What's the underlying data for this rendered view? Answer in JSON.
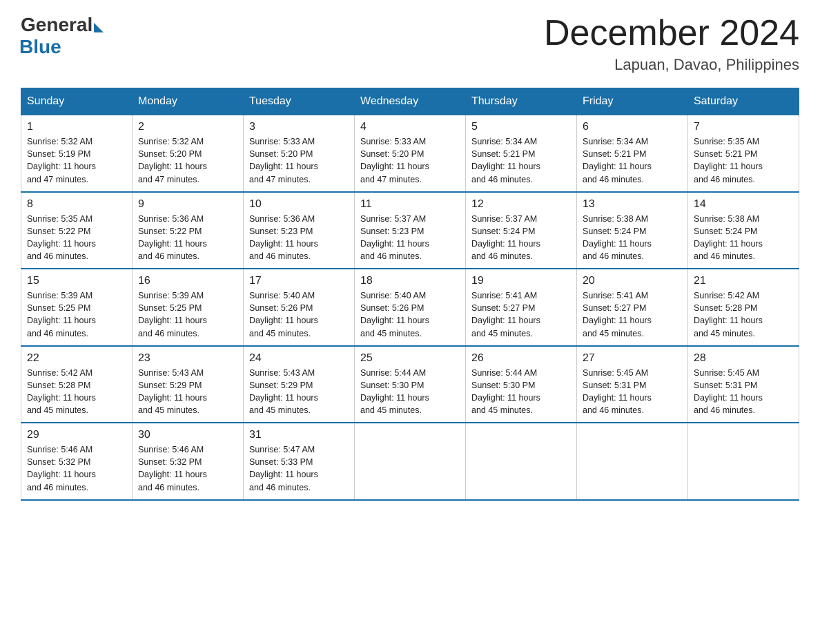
{
  "header": {
    "logo_general": "General",
    "logo_blue": "Blue",
    "month_title": "December 2024",
    "location": "Lapuan, Davao, Philippines"
  },
  "days_of_week": [
    "Sunday",
    "Monday",
    "Tuesday",
    "Wednesday",
    "Thursday",
    "Friday",
    "Saturday"
  ],
  "weeks": [
    [
      {
        "day": "1",
        "sunrise": "5:32 AM",
        "sunset": "5:19 PM",
        "daylight": "11 hours and 47 minutes."
      },
      {
        "day": "2",
        "sunrise": "5:32 AM",
        "sunset": "5:20 PM",
        "daylight": "11 hours and 47 minutes."
      },
      {
        "day": "3",
        "sunrise": "5:33 AM",
        "sunset": "5:20 PM",
        "daylight": "11 hours and 47 minutes."
      },
      {
        "day": "4",
        "sunrise": "5:33 AM",
        "sunset": "5:20 PM",
        "daylight": "11 hours and 47 minutes."
      },
      {
        "day": "5",
        "sunrise": "5:34 AM",
        "sunset": "5:21 PM",
        "daylight": "11 hours and 46 minutes."
      },
      {
        "day": "6",
        "sunrise": "5:34 AM",
        "sunset": "5:21 PM",
        "daylight": "11 hours and 46 minutes."
      },
      {
        "day": "7",
        "sunrise": "5:35 AM",
        "sunset": "5:21 PM",
        "daylight": "11 hours and 46 minutes."
      }
    ],
    [
      {
        "day": "8",
        "sunrise": "5:35 AM",
        "sunset": "5:22 PM",
        "daylight": "11 hours and 46 minutes."
      },
      {
        "day": "9",
        "sunrise": "5:36 AM",
        "sunset": "5:22 PM",
        "daylight": "11 hours and 46 minutes."
      },
      {
        "day": "10",
        "sunrise": "5:36 AM",
        "sunset": "5:23 PM",
        "daylight": "11 hours and 46 minutes."
      },
      {
        "day": "11",
        "sunrise": "5:37 AM",
        "sunset": "5:23 PM",
        "daylight": "11 hours and 46 minutes."
      },
      {
        "day": "12",
        "sunrise": "5:37 AM",
        "sunset": "5:24 PM",
        "daylight": "11 hours and 46 minutes."
      },
      {
        "day": "13",
        "sunrise": "5:38 AM",
        "sunset": "5:24 PM",
        "daylight": "11 hours and 46 minutes."
      },
      {
        "day": "14",
        "sunrise": "5:38 AM",
        "sunset": "5:24 PM",
        "daylight": "11 hours and 46 minutes."
      }
    ],
    [
      {
        "day": "15",
        "sunrise": "5:39 AM",
        "sunset": "5:25 PM",
        "daylight": "11 hours and 46 minutes."
      },
      {
        "day": "16",
        "sunrise": "5:39 AM",
        "sunset": "5:25 PM",
        "daylight": "11 hours and 46 minutes."
      },
      {
        "day": "17",
        "sunrise": "5:40 AM",
        "sunset": "5:26 PM",
        "daylight": "11 hours and 45 minutes."
      },
      {
        "day": "18",
        "sunrise": "5:40 AM",
        "sunset": "5:26 PM",
        "daylight": "11 hours and 45 minutes."
      },
      {
        "day": "19",
        "sunrise": "5:41 AM",
        "sunset": "5:27 PM",
        "daylight": "11 hours and 45 minutes."
      },
      {
        "day": "20",
        "sunrise": "5:41 AM",
        "sunset": "5:27 PM",
        "daylight": "11 hours and 45 minutes."
      },
      {
        "day": "21",
        "sunrise": "5:42 AM",
        "sunset": "5:28 PM",
        "daylight": "11 hours and 45 minutes."
      }
    ],
    [
      {
        "day": "22",
        "sunrise": "5:42 AM",
        "sunset": "5:28 PM",
        "daylight": "11 hours and 45 minutes."
      },
      {
        "day": "23",
        "sunrise": "5:43 AM",
        "sunset": "5:29 PM",
        "daylight": "11 hours and 45 minutes."
      },
      {
        "day": "24",
        "sunrise": "5:43 AM",
        "sunset": "5:29 PM",
        "daylight": "11 hours and 45 minutes."
      },
      {
        "day": "25",
        "sunrise": "5:44 AM",
        "sunset": "5:30 PM",
        "daylight": "11 hours and 45 minutes."
      },
      {
        "day": "26",
        "sunrise": "5:44 AM",
        "sunset": "5:30 PM",
        "daylight": "11 hours and 45 minutes."
      },
      {
        "day": "27",
        "sunrise": "5:45 AM",
        "sunset": "5:31 PM",
        "daylight": "11 hours and 46 minutes."
      },
      {
        "day": "28",
        "sunrise": "5:45 AM",
        "sunset": "5:31 PM",
        "daylight": "11 hours and 46 minutes."
      }
    ],
    [
      {
        "day": "29",
        "sunrise": "5:46 AM",
        "sunset": "5:32 PM",
        "daylight": "11 hours and 46 minutes."
      },
      {
        "day": "30",
        "sunrise": "5:46 AM",
        "sunset": "5:32 PM",
        "daylight": "11 hours and 46 minutes."
      },
      {
        "day": "31",
        "sunrise": "5:47 AM",
        "sunset": "5:33 PM",
        "daylight": "11 hours and 46 minutes."
      },
      null,
      null,
      null,
      null
    ]
  ],
  "labels": {
    "sunrise": "Sunrise:",
    "sunset": "Sunset:",
    "daylight": "Daylight:"
  },
  "colors": {
    "header_bg": "#1a6fa8",
    "header_text": "#ffffff",
    "border": "#1a6fa8"
  }
}
